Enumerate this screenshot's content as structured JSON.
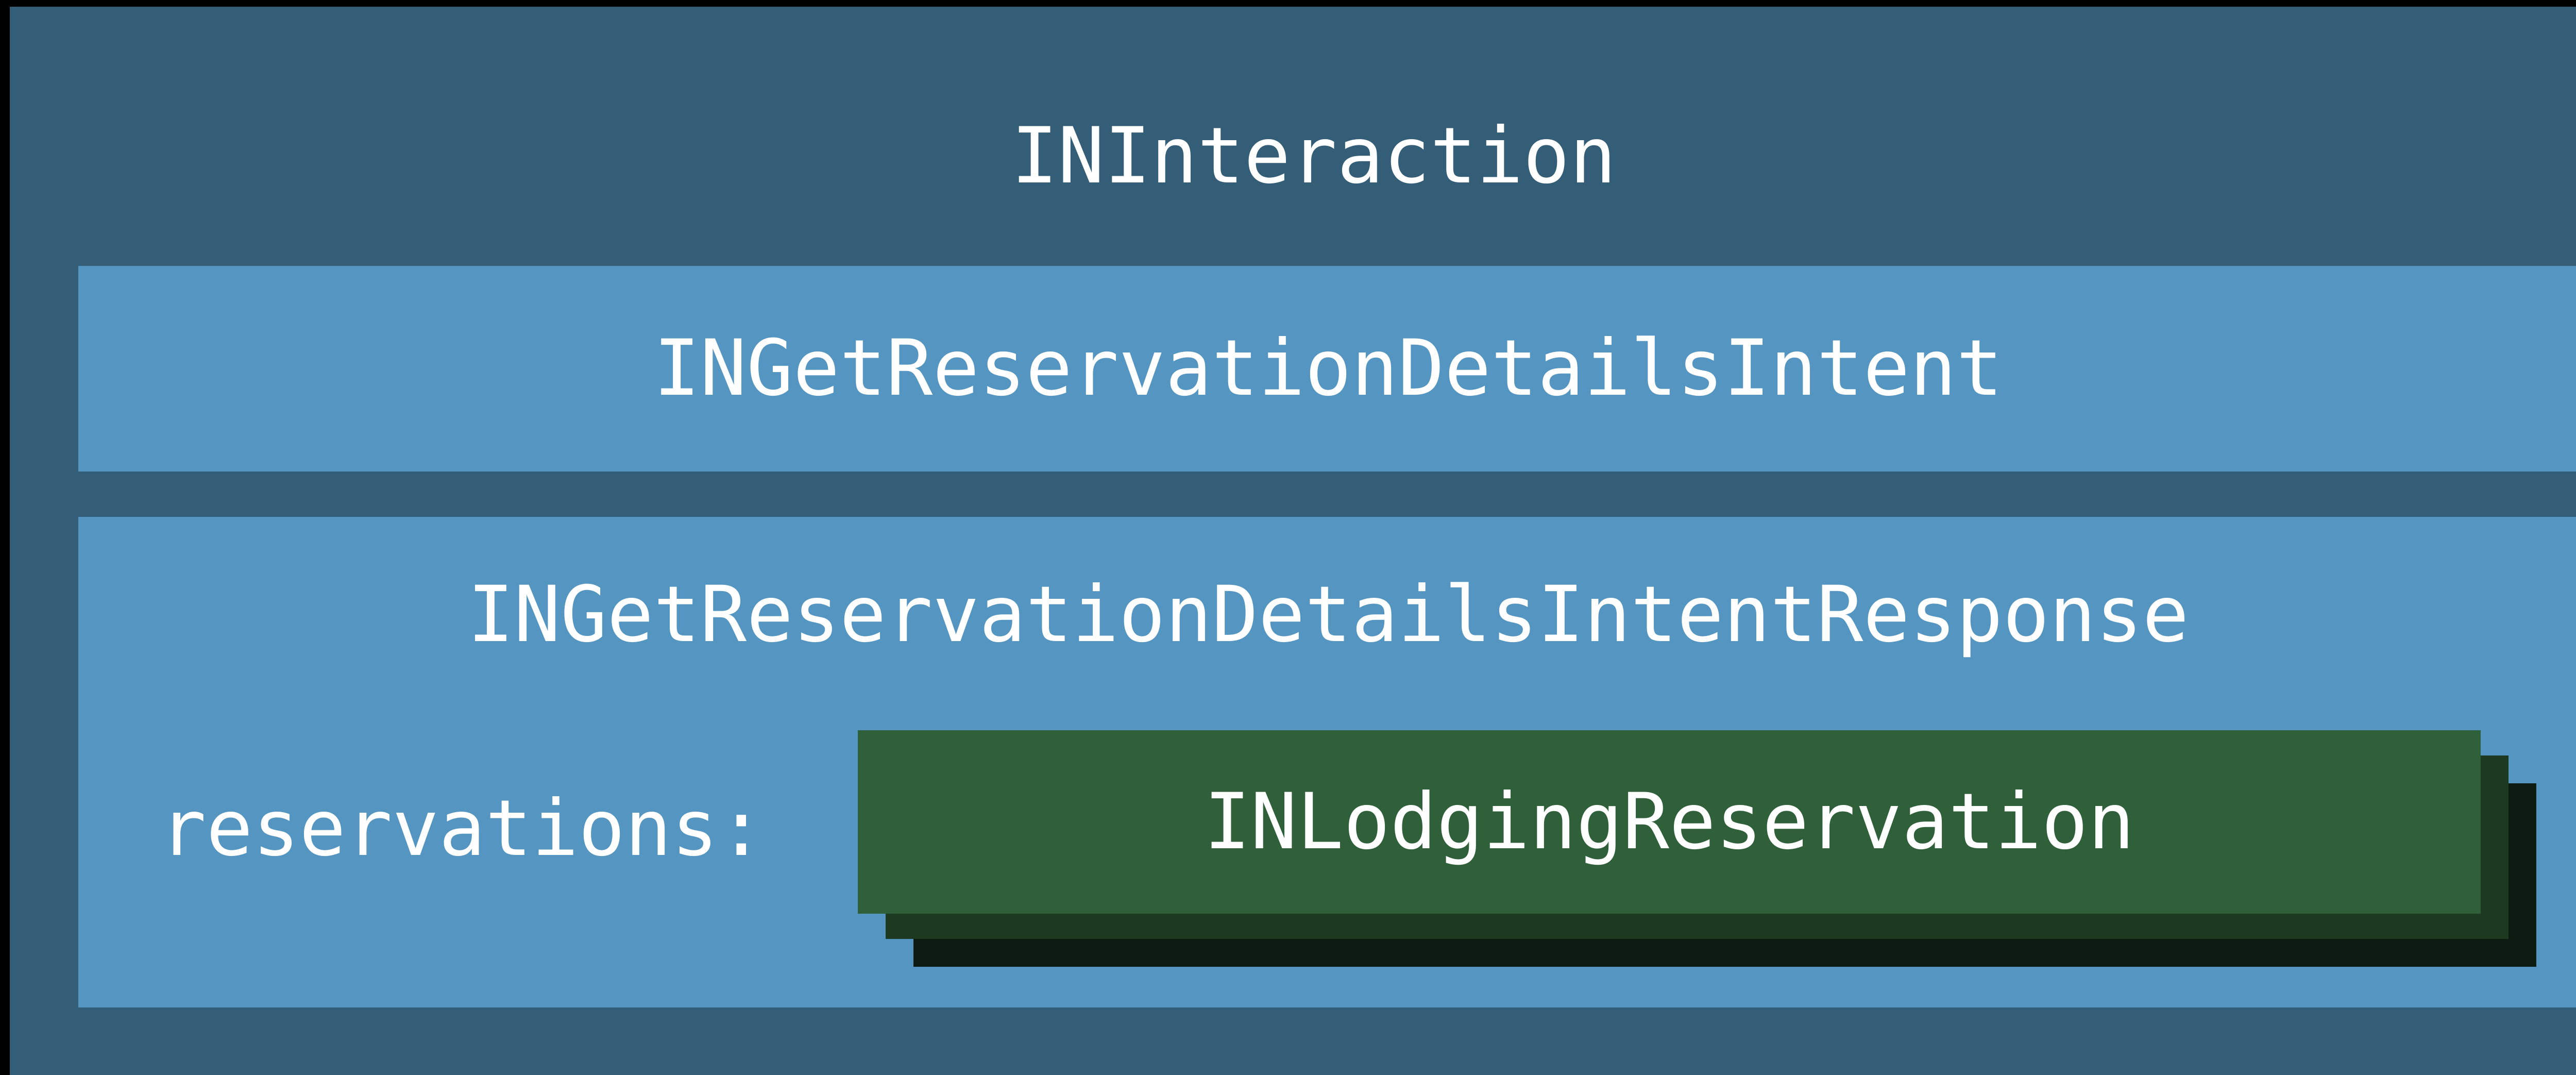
{
  "diagram": {
    "title": "INInteraction",
    "intent": {
      "label": "INGetReservationDetailsIntent"
    },
    "response": {
      "label": "INGetReservationDetailsIntentResponse",
      "property_label": "reservations:",
      "reservation_card": {
        "label": "INLodgingReservation"
      }
    }
  },
  "colors": {
    "background": "#000000",
    "outer_box": "#345d77",
    "inner_box": "#5496c1",
    "card_front": "#30603a",
    "card_middle": "#1d3a20",
    "card_back": "#0c1a11",
    "text": "#ffffff"
  }
}
